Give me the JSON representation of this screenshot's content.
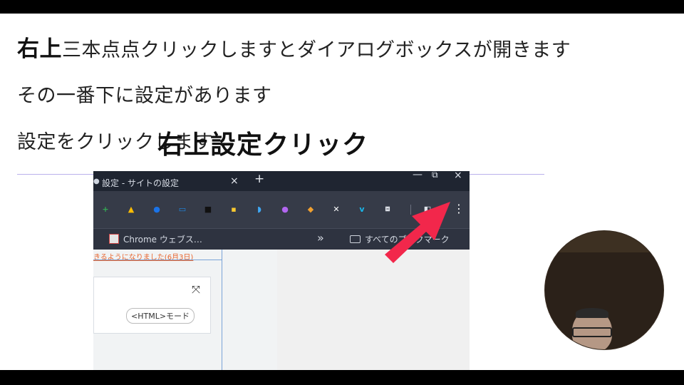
{
  "caption": {
    "line1_bold": "右上",
    "line1_rest": "三本点点クリックしますとダイアログボックスが開きます",
    "line2": "その一番下に設定があります",
    "line3": "設定をクリックします"
  },
  "browser": {
    "tab_title": "設定 - サイトの設定",
    "tab_close": "×",
    "new_tab": "+",
    "window_minimize": "—",
    "window_restore": "⧉",
    "window_close": "×",
    "menu_glyph": "⋮",
    "extensions": [
      {
        "icon": "plus-circle-icon",
        "color": "#34a853",
        "glyph": "+"
      },
      {
        "icon": "drive-icon",
        "color": "#fbbc04",
        "glyph": "▲"
      },
      {
        "icon": "globe-icon",
        "color": "#1a73e8",
        "glyph": "●"
      },
      {
        "icon": "cast-icon",
        "color": "#1e88e5",
        "glyph": "▭"
      },
      {
        "icon": "dark-square-icon",
        "color": "#111111",
        "glyph": "■"
      },
      {
        "icon": "yellow-note-icon",
        "color": "#f9c930",
        "glyph": "▪"
      },
      {
        "icon": "shield-icon",
        "color": "#3fa8f4",
        "glyph": "◗"
      },
      {
        "icon": "purple-sphere-icon",
        "color": "#b266f0",
        "glyph": "●"
      },
      {
        "icon": "medal-icon",
        "color": "#f0a030",
        "glyph": "◆"
      },
      {
        "icon": "x-icon",
        "color": "#ffffff",
        "glyph": "✕"
      },
      {
        "icon": "vimeo-icon",
        "color": "#1ab7ea",
        "glyph": "v"
      },
      {
        "icon": "puzzle-icon",
        "color": "#dfe3ea",
        "glyph": "⧈"
      },
      {
        "icon": "side-panel-icon",
        "color": "#dfe3ea",
        "glyph": "◧"
      }
    ],
    "bookmark_label": "Chrome ウェブス…",
    "bookmarks_overflow": "»",
    "bookmark_folder_label": "すべてのブックマーク",
    "page_notice": "きるようになりました(6月3日)",
    "expand_glyph": "⤧",
    "mode_button": "<HTML>モード"
  },
  "annotation": {
    "callout": "右上設定クリック",
    "arrow_color": "#f2274b"
  }
}
